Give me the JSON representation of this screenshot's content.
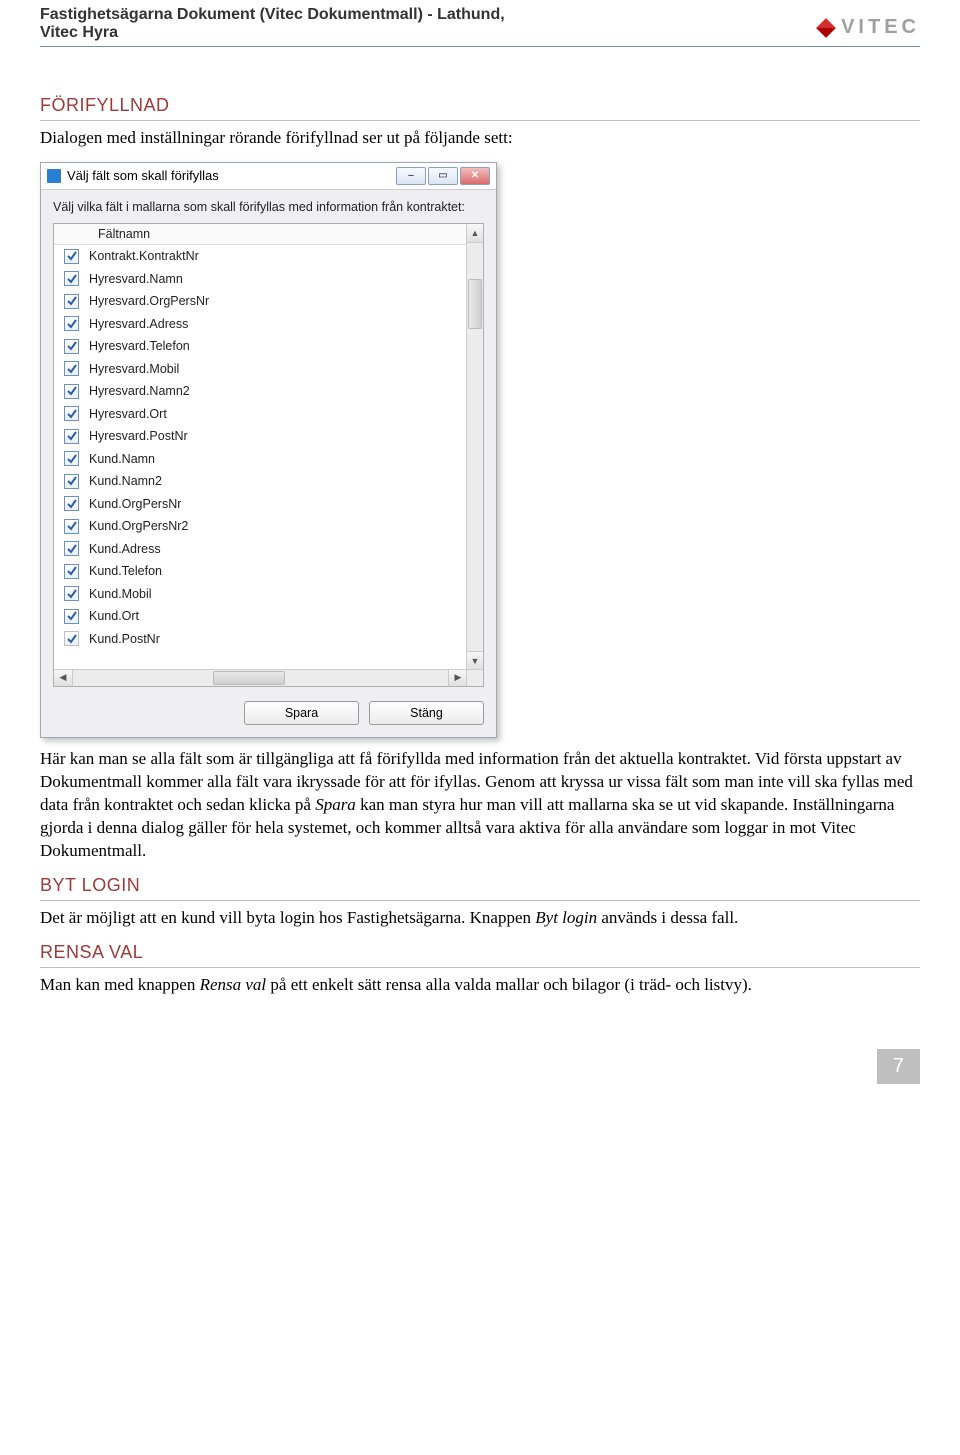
{
  "header": {
    "title_line1": "Fastighetsägarna Dokument (Vitec Dokumentmall) - Lathund,",
    "title_line2": "Vitec Hyra",
    "brand_text": "VITEC"
  },
  "sections": {
    "forifyllnad": {
      "title": "FÖRIFYLLNAD",
      "intro": "Dialogen med inställningar rörande förifyllnad ser ut på följande sett:",
      "desc1": "Här kan man se alla fält som är tillgängliga att få förifyllda med information från det aktuella kontraktet. Vid första uppstart av Dokumentmall kommer alla fält vara ikryssade för att för ifyllas. Genom att kryssa ur vissa fält som man inte vill ska fyllas med data från kontraktet och sedan klicka på ",
      "desc1_em": "Spara",
      "desc1_cont": " kan man styra hur man vill att mallarna ska se ut vid skapande. Inställningarna gjorda i denna dialog gäller för hela systemet, och kommer alltså vara aktiva för alla användare som loggar in mot Vitec Dokumentmall."
    },
    "byt_login": {
      "title": "BYT LOGIN",
      "body_pre": "Det är möjligt att en kund vill byta login hos Fastighetsägarna. Knappen ",
      "body_em": "Byt login",
      "body_post": " används i dessa fall."
    },
    "rensa_val": {
      "title": "RENSA VAL",
      "body_pre": "Man kan med knappen ",
      "body_em": "Rensa val",
      "body_post": " på ett enkelt sätt rensa alla valda mallar och bilagor (i träd- och listvy)."
    }
  },
  "dialog": {
    "title": "Välj fält som skall förifyllas",
    "description": "Välj vilka fält i mallarna som skall förifyllas med information från kontraktet:",
    "column_header": "Fältnamn",
    "fields": [
      {
        "label": "Kontrakt.KontraktNr",
        "checked": true
      },
      {
        "label": "Hyresvard.Namn",
        "checked": true
      },
      {
        "label": "Hyresvard.OrgPersNr",
        "checked": true
      },
      {
        "label": "Hyresvard.Adress",
        "checked": true
      },
      {
        "label": "Hyresvard.Telefon",
        "checked": true
      },
      {
        "label": "Hyresvard.Mobil",
        "checked": true
      },
      {
        "label": "Hyresvard.Namn2",
        "checked": true
      },
      {
        "label": "Hyresvard.Ort",
        "checked": true
      },
      {
        "label": "Hyresvard.PostNr",
        "checked": true
      },
      {
        "label": "Kund.Namn",
        "checked": true
      },
      {
        "label": "Kund.Namn2",
        "checked": true
      },
      {
        "label": "Kund.OrgPersNr",
        "checked": true
      },
      {
        "label": "Kund.OrgPersNr2",
        "checked": true
      },
      {
        "label": "Kund.Adress",
        "checked": true
      },
      {
        "label": "Kund.Telefon",
        "checked": true
      },
      {
        "label": "Kund.Mobil",
        "checked": true
      },
      {
        "label": "Kund.Ort",
        "checked": true
      },
      {
        "label": "Kund.PostNr",
        "checked": true
      }
    ],
    "buttons": {
      "save": "Spara",
      "close": "Stäng"
    }
  },
  "page_number": "7"
}
